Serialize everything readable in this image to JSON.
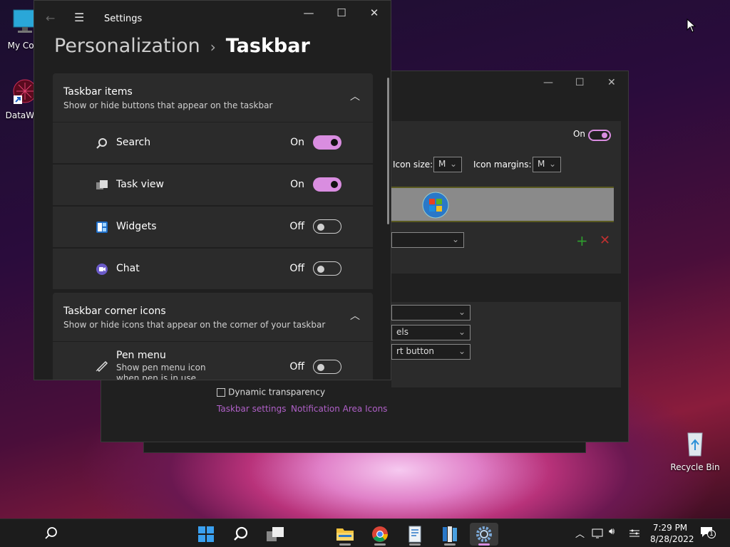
{
  "desktop": {
    "icons": [
      {
        "label": "My Com",
        "icon": "monitor-icon"
      },
      {
        "label": "DataWag",
        "icon": "datawag-shortcut-icon"
      },
      {
        "label": "Recycle Bin",
        "icon": "recycle-bin-icon"
      }
    ]
  },
  "back_window": {
    "toggle_state": "On",
    "icon_size_label": "Icon size:",
    "icon_size_value": "M",
    "icon_margins_label": "Icon margins:",
    "icon_margins_value": "M",
    "combo_2_value": "els",
    "combo_3_value": "rt button",
    "dynamic_transparency_label": "Dynamic transparency",
    "taskbar_settings_link": "Taskbar settings",
    "notification_area_link": "Notification Area Icons"
  },
  "settings": {
    "app_title": "Settings",
    "breadcrumb_parent": "Personalization",
    "breadcrumb_separator": "›",
    "breadcrumb_current": "Taskbar",
    "taskbar_items": {
      "title": "Taskbar items",
      "description": "Show or hide buttons that appear on the taskbar",
      "rows": [
        {
          "label": "Search",
          "state": "On",
          "on": true,
          "icon": "search-icon"
        },
        {
          "label": "Task view",
          "state": "On",
          "on": true,
          "icon": "task-view-icon"
        },
        {
          "label": "Widgets",
          "state": "Off",
          "on": false,
          "icon": "widgets-icon"
        },
        {
          "label": "Chat",
          "state": "Off",
          "on": false,
          "icon": "chat-icon"
        }
      ]
    },
    "corner_icons": {
      "title": "Taskbar corner icons",
      "description": "Show or hide icons that appear on the corner of your taskbar",
      "pen_menu_label": "Pen menu",
      "pen_menu_desc_1": "Show pen menu icon",
      "pen_menu_desc_2": "when pen is in use",
      "pen_menu_state": "Off"
    }
  },
  "taskbar": {
    "time": "7:29 PM",
    "date": "8/28/2022",
    "notification_count": "1"
  },
  "colors": {
    "accent": "#d98de0",
    "window_bg": "#1f1f1f",
    "card_bg": "#2b2b2b",
    "taskbar_bg": "#1c1c1c"
  }
}
